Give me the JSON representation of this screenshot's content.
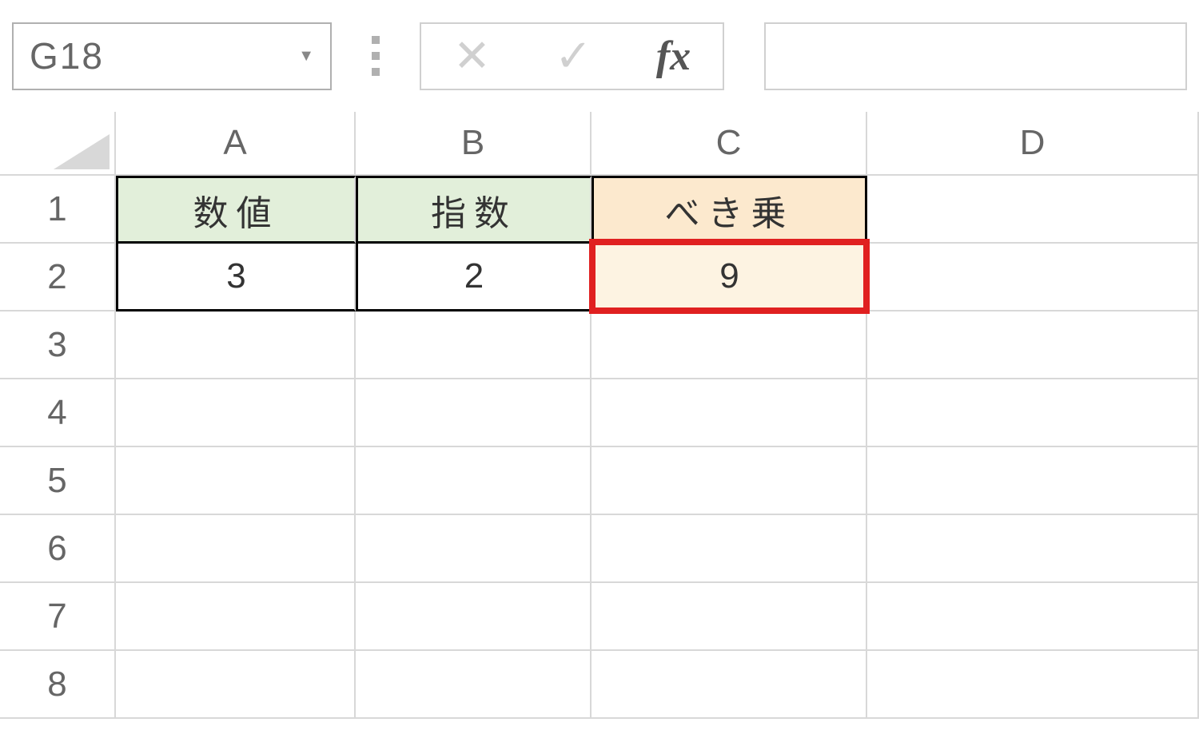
{
  "formula_bar": {
    "name_box_value": "G18",
    "fx_label": "fx",
    "formula_value": ""
  },
  "columns": [
    "A",
    "B",
    "C",
    "D"
  ],
  "rows": [
    "1",
    "2",
    "3",
    "4",
    "5",
    "6",
    "7",
    "8"
  ],
  "table": {
    "headers": {
      "a1": "数値",
      "b1": "指数",
      "c1": "べき乗"
    },
    "data": {
      "a2": "3",
      "b2": "2",
      "c2": "9"
    }
  }
}
